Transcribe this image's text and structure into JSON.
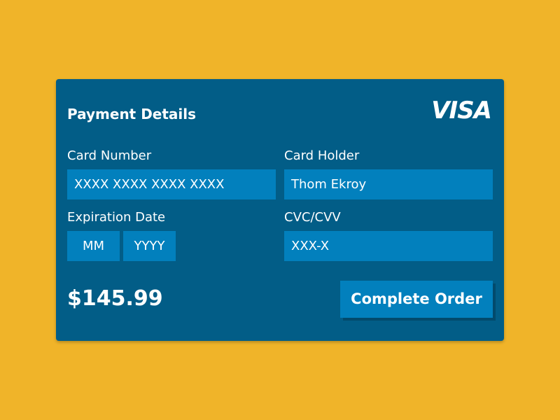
{
  "form": {
    "title": "Payment Details",
    "brand": "VISA",
    "card_number": {
      "label": "Card Number",
      "value": "XXXX XXXX XXXX XXXX"
    },
    "card_holder": {
      "label": "Card Holder",
      "value": "Thom Ekroy"
    },
    "expiration": {
      "label": "Expiration Date",
      "month": "MM",
      "year": "YYYY"
    },
    "cvc": {
      "label": "CVC/CVV",
      "value": "XXX-X"
    },
    "price": "$145.99",
    "submit_label": "Complete Order"
  },
  "colors": {
    "background": "#f0b429",
    "card": "#025d87",
    "field": "#0280bd",
    "button_shadow": "#024a6c",
    "text": "#ffffff"
  }
}
